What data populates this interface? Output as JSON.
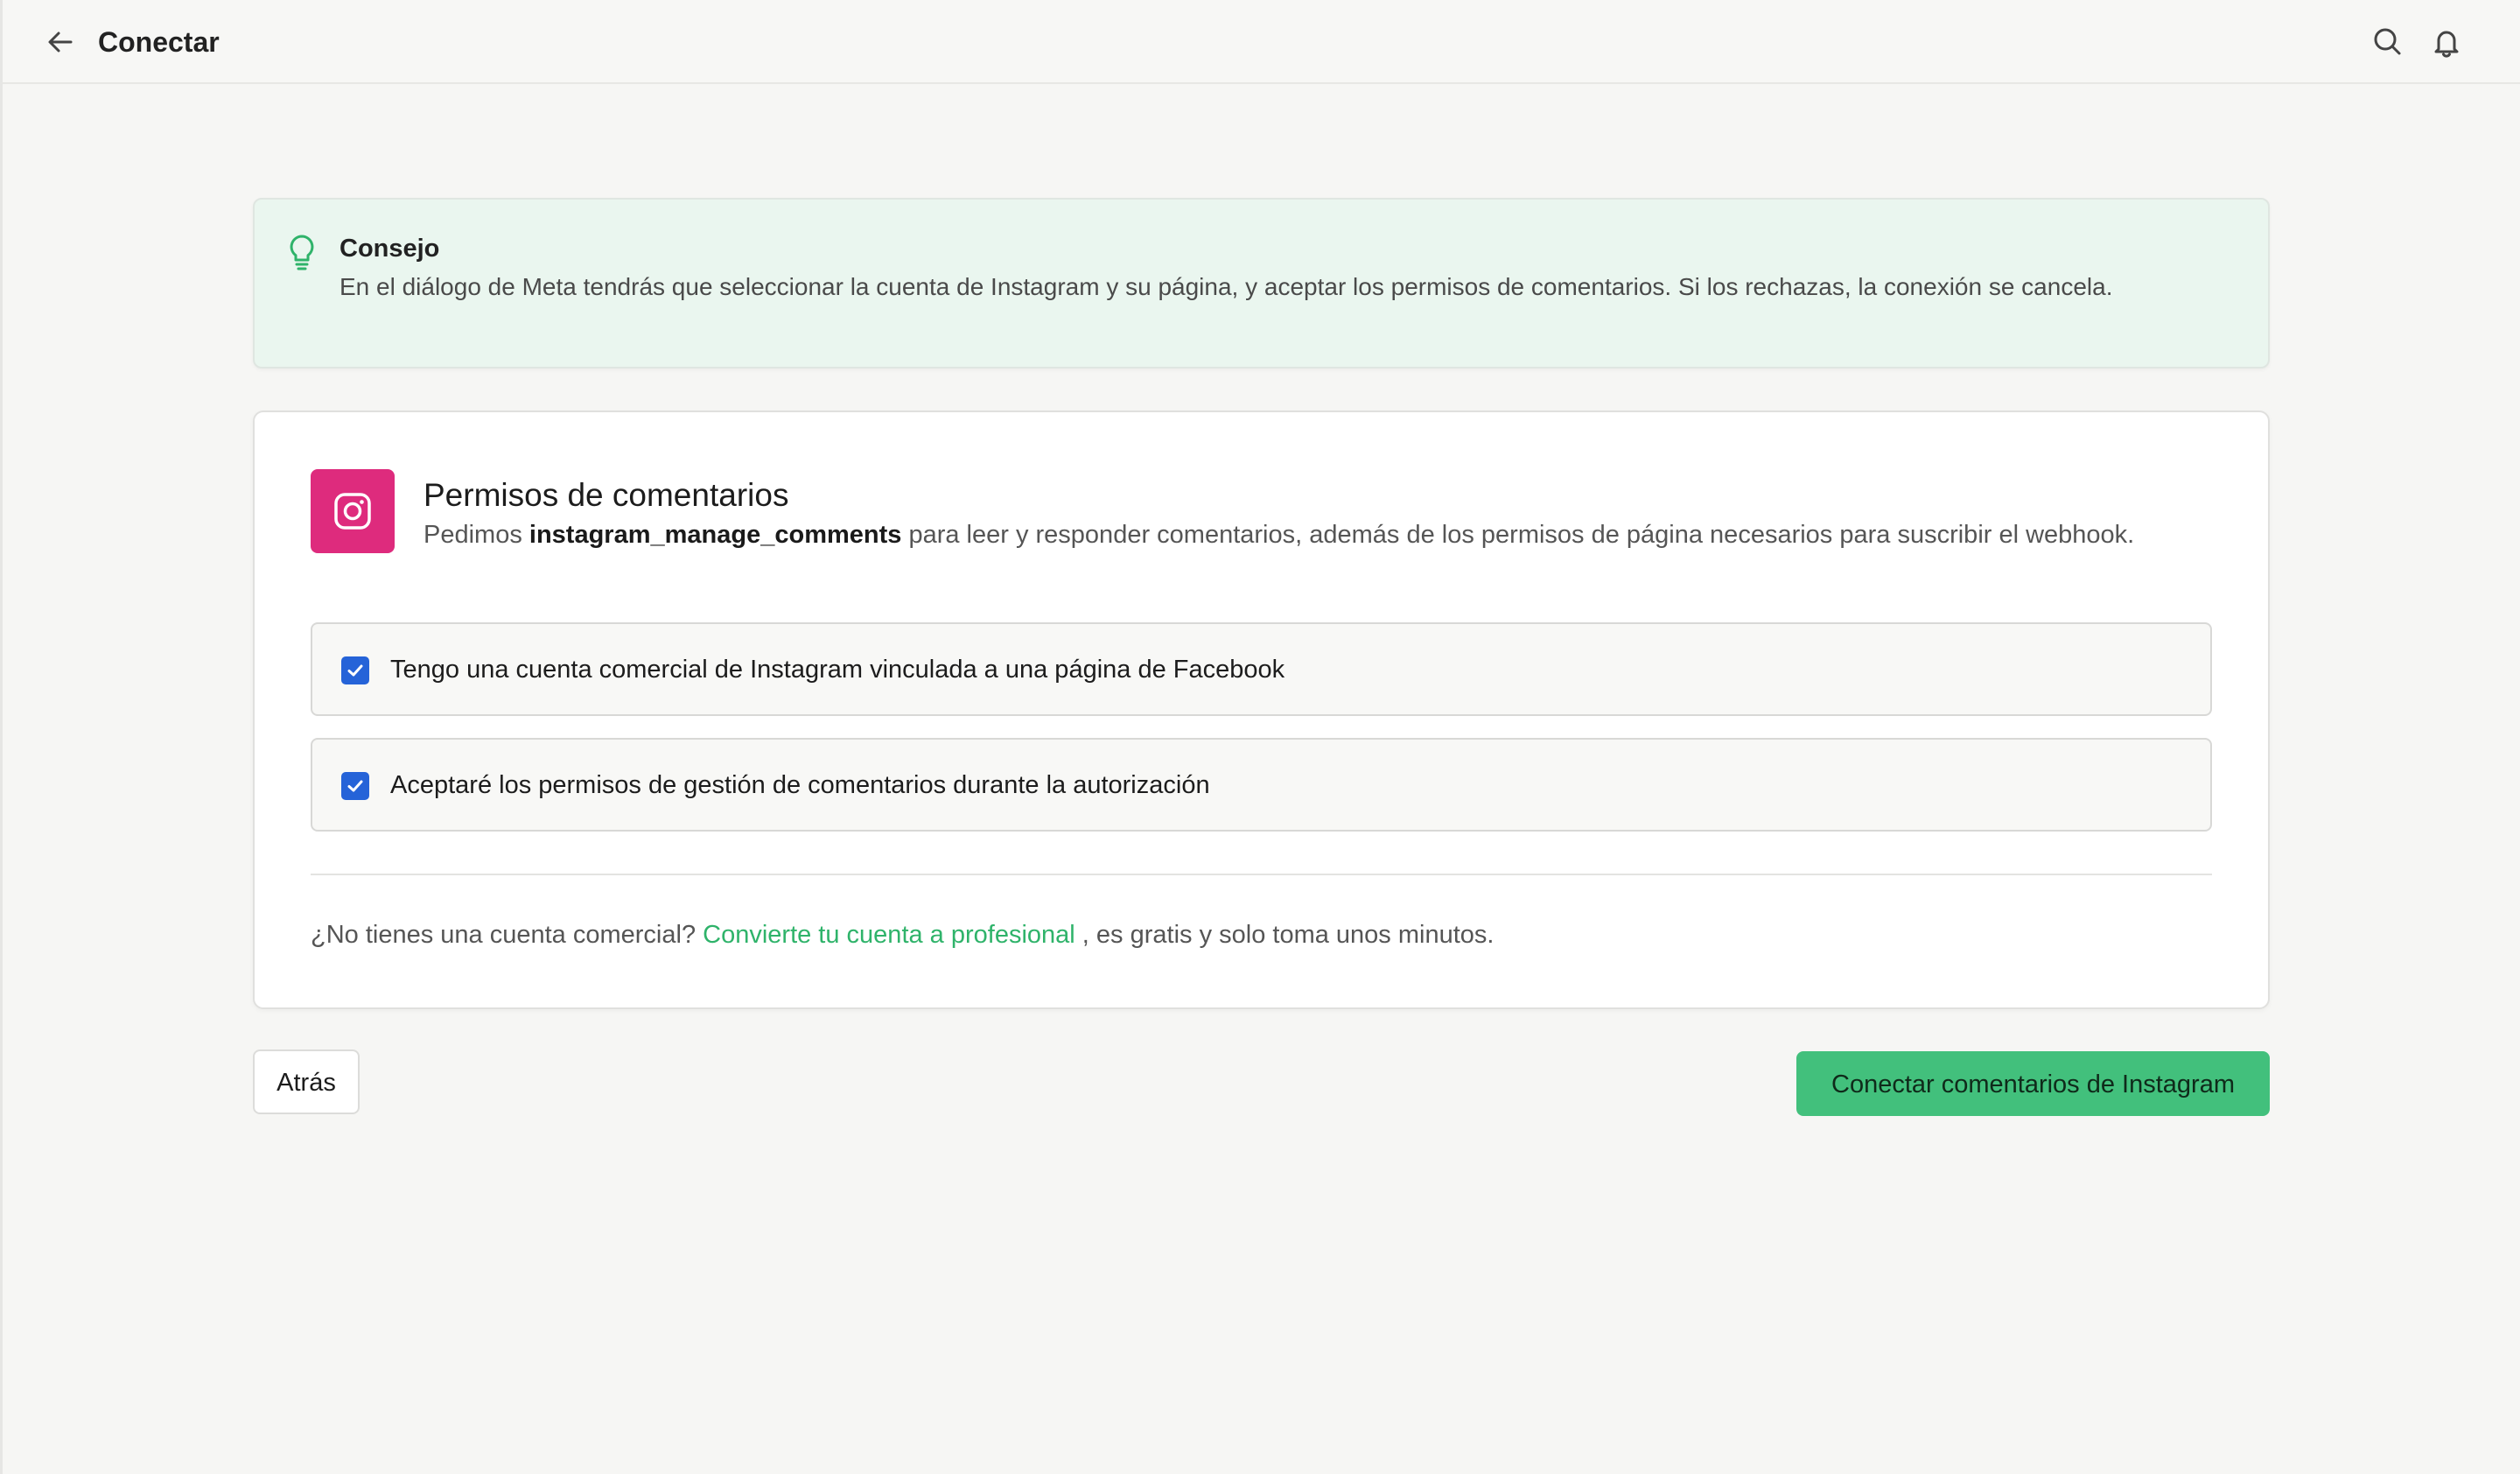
{
  "header": {
    "title": "Conectar",
    "back_icon": "arrow-left-icon",
    "actions": [
      {
        "icon": "search-icon"
      },
      {
        "icon": "bell-icon"
      }
    ]
  },
  "tip": {
    "icon": "lightbulb-icon",
    "title": "Consejo",
    "body": "En el diálogo de Meta tendrás que seleccionar la cuenta de Instagram y su página, y aceptar los permisos de comentarios. Si los rechazas, la conexión se cancela.",
    "accent_color": "#2fb36a"
  },
  "card": {
    "icon": "instagram-icon",
    "icon_bg_color": "#de2b7d",
    "title": "Permisos de comentarios",
    "desc_prefix": "Pedimos ",
    "desc_strong": "instagram_manage_comments",
    "desc_suffix": " para leer y responder comentarios, además de los permisos de página necesarios para suscribir el webhook.",
    "checks": [
      {
        "label": "Tengo una cuenta comercial de Instagram vinculada a una página de Facebook",
        "checked": true
      },
      {
        "label": "Aceptaré los permisos de gestión de comentarios durante la autorización",
        "checked": true
      }
    ],
    "footer_prefix": "¿No tienes una cuenta comercial? ",
    "footer_link": "Convierte tu cuenta a profesional",
    "footer_suffix": " , es gratis y solo toma unos minutos."
  },
  "actions": {
    "back_label": "Atrás",
    "connect_label": "Conectar comentarios de Instagram",
    "primary_color": "#42c07c",
    "checkbox_color": "#2563d8"
  }
}
